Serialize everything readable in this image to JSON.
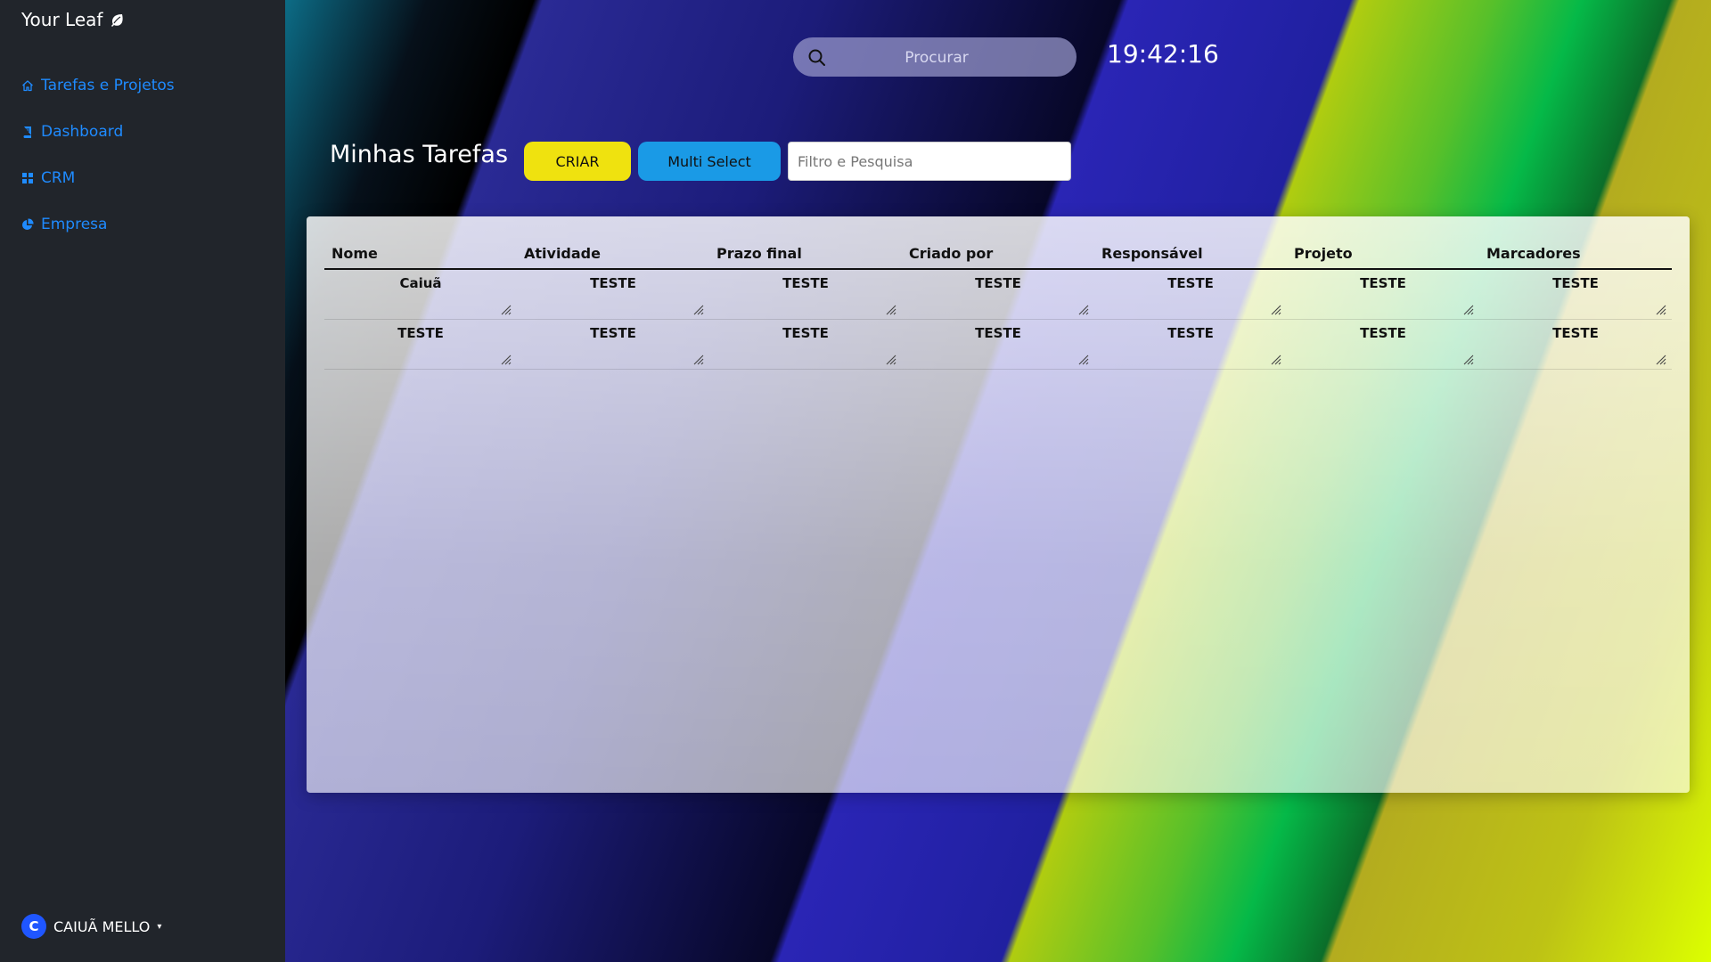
{
  "sidebar": {
    "brand": "Your Leaf",
    "brand_icon": "leaf-icon",
    "nav": [
      {
        "label": "Tarefas e Projetos",
        "icon": "home-icon"
      },
      {
        "label": "Dashboard",
        "icon": "book-icon"
      },
      {
        "label": "CRM",
        "icon": "grid-icon"
      },
      {
        "label": "Empresa",
        "icon": "pie-chart-icon"
      }
    ],
    "user": {
      "initial": "C",
      "name": "CAIUÃ MELLO",
      "caret": "▾"
    }
  },
  "header": {
    "search_placeholder": "Procurar",
    "clock": "19:42:16"
  },
  "toolbar": {
    "title": "Minhas Tarefas",
    "criar_label": "CRIAR",
    "multi_label": "Multi Select",
    "filter_placeholder": "Filtro e Pesquisa"
  },
  "table": {
    "columns": [
      "Nome",
      "Atividade",
      "Prazo final",
      "Criado por",
      "Responsável",
      "Projeto",
      "Marcadores"
    ],
    "rows": [
      [
        "Caiuã",
        "TESTE",
        "TESTE",
        "TESTE",
        "TESTE",
        "TESTE",
        "TESTE"
      ],
      [
        "TESTE",
        "TESTE",
        "TESTE",
        "TESTE",
        "TESTE",
        "TESTE",
        "TESTE"
      ]
    ]
  },
  "colors": {
    "sidebar_bg": "#21252b",
    "nav_link": "#1f8bff",
    "criar_button": "#efe20f",
    "multi_button": "#1a9ae6",
    "avatar": "#1f56ff"
  }
}
